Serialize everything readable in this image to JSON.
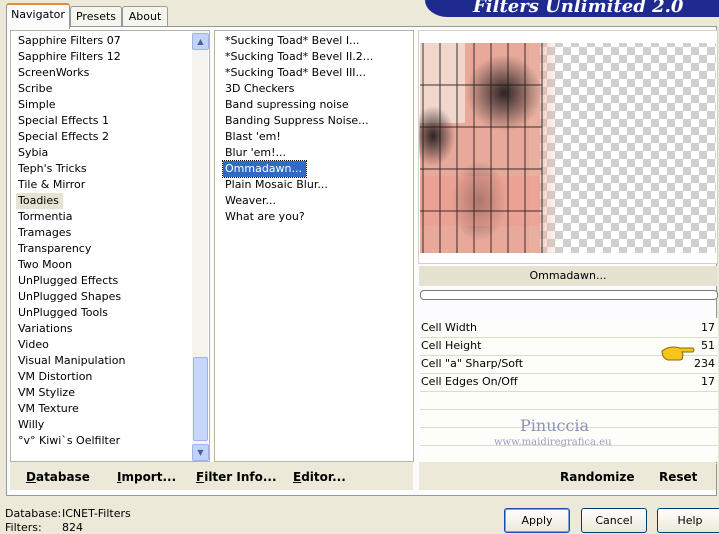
{
  "tabs": [
    {
      "label": "Navigator"
    },
    {
      "label": "Presets"
    },
    {
      "label": "About"
    }
  ],
  "banner_title": "Filters Unlimited 2.0",
  "categories": [
    "Sapphire Filters 07",
    "Sapphire Filters 12",
    "ScreenWorks",
    "Scribe",
    "Simple",
    "Special Effects 1",
    "Special Effects 2",
    "Sybia",
    "Teph's Tricks",
    "Tile & Mirror",
    "Toadies",
    "Tormentia",
    "Tramages",
    "Transparency",
    "Two Moon",
    "UnPlugged Effects",
    "UnPlugged Shapes",
    "UnPlugged Tools",
    "Variations",
    "Video",
    "Visual Manipulation",
    "VM Distortion",
    "VM Stylize",
    "VM Texture",
    "Willy",
    "°v° Kiwi`s Oelfilter"
  ],
  "filters": [
    "*Sucking Toad*  Bevel I...",
    "*Sucking Toad*  Bevel II.2...",
    "*Sucking Toad*  Bevel III...",
    "3D Checkers",
    "Band supressing noise",
    "Banding Suppress Noise...",
    "Blast 'em!",
    "Blur 'em!...",
    "Ommadawn...",
    "Plain Mosaic Blur...",
    "Weaver...",
    "What are you?"
  ],
  "selected_category": "Toadies",
  "selected_filter": "Ommadawn...",
  "preview_filter_name": "Ommadawn...",
  "params": [
    {
      "label": "Cell Width",
      "value": "17"
    },
    {
      "label": "Cell Height",
      "value": "51"
    },
    {
      "label": "Cell \"a\" Sharp/Soft",
      "value": "234"
    },
    {
      "label": "Cell Edges On/Off",
      "value": "17"
    }
  ],
  "watermark": {
    "name": "Pinuccia",
    "url": "www.maidiregrafica.eu"
  },
  "left_buttons": {
    "database": "Database",
    "import": "Import...",
    "filter_info": "Filter Info...",
    "editor": "Editor..."
  },
  "right_buttons": {
    "randomize": "Randomize",
    "reset": "Reset"
  },
  "status": {
    "db_label": "Database:",
    "db_value": "ICNET-Filters",
    "filters_label": "Filters:",
    "filters_value": "824"
  },
  "dialog_buttons": {
    "apply": "Apply",
    "cancel": "Cancel",
    "help": "Help"
  },
  "colors": {
    "banner": "#1e2a8e",
    "selection": "#316ac5",
    "tab_accent": "#e68b2c"
  }
}
